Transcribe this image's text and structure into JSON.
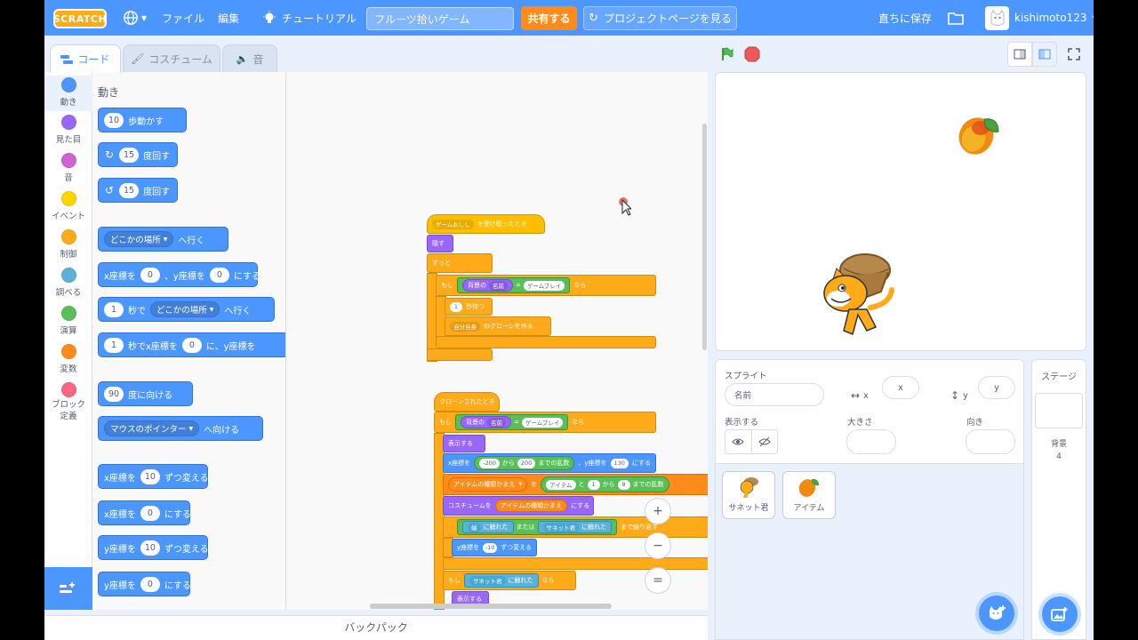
{
  "menubar": {
    "logo": "SCRATCH",
    "file": "ファイル",
    "edit": "編集",
    "tutorials": "チュートリアル",
    "project_title": "フルーツ拾いゲーム",
    "share": "共有する",
    "see_project_page": "プロジェクトページを見る",
    "save_now": "直ちに保存",
    "username": "kishimoto123"
  },
  "tabs": {
    "code": "コード",
    "costumes": "コスチューム",
    "sounds": "音"
  },
  "categories": [
    {
      "label": "動き",
      "color": "#4c97ff"
    },
    {
      "label": "見た目",
      "color": "#9966ff"
    },
    {
      "label": "音",
      "color": "#cf63cf"
    },
    {
      "label": "イベント",
      "color": "#ffd500"
    },
    {
      "label": "制御",
      "color": "#ffab19"
    },
    {
      "label": "調べる",
      "color": "#5cb1d6"
    },
    {
      "label": "演算",
      "color": "#59c059"
    },
    {
      "label": "変数",
      "color": "#ff8c1a"
    },
    {
      "label": "ブロック定義",
      "color": "#ff6680"
    }
  ],
  "palette": {
    "title": "動き",
    "blocks": {
      "move": {
        "v1": "10",
        "t1": "歩動かす"
      },
      "turn_right": {
        "v1": "15",
        "t1": "度回す"
      },
      "turn_left": {
        "v1": "15",
        "t1": "度回す"
      },
      "goto": {
        "dd": "どこかの場所",
        "t1": "へ行く"
      },
      "gotoxy": {
        "t1": "x座標を",
        "v1": "0",
        "t2": "、y座標を",
        "v2": "0",
        "t3": "にする"
      },
      "glide": {
        "v1": "1",
        "t1": "秒で",
        "dd": "どこかの場所",
        "t2": "へ行く"
      },
      "glidexy": {
        "v1": "1",
        "t1": "秒でx座標を",
        "v2": "0",
        "t2": "に、y座標を"
      },
      "point": {
        "v1": "90",
        "t1": "度に向ける"
      },
      "pointto": {
        "dd": "マウスのポインター",
        "t1": "へ向ける"
      },
      "changex": {
        "t1": "x座標を",
        "v1": "10",
        "t2": "ずつ変える"
      },
      "setx": {
        "t1": "x座標を",
        "v1": "0",
        "t2": "にする"
      },
      "changey": {
        "t1": "y座標を",
        "v1": "10",
        "t2": "ずつ変える"
      },
      "sety": {
        "t1": "y座標を",
        "v1": "0",
        "t2": "にする"
      }
    }
  },
  "script1": {
    "hat_dd": "ゲームおしし",
    "hat": "を受け取ったとき",
    "hide": "隠す",
    "forever": "ずっと",
    "if": "もし",
    "bg_name": "背景の",
    "name_dd": "名前",
    "eq": "=",
    "game_play": "ゲームプレイ",
    "then": "なら",
    "wait_v": "1",
    "wait": "秒待つ",
    "myself_dd": "自分自身",
    "clone": "のクローンを作る"
  },
  "script2": {
    "hat": "クローンされたとき",
    "if": "もし",
    "bg_name": "背景の",
    "name_dd": "名前",
    "eq": "=",
    "game_play": "ゲームプレイ",
    "then": "なら",
    "show": "表示する",
    "xlabel": "x座標を",
    "xmin": "-200",
    "from": "から",
    "xmax": "200",
    "rand": "までの乱数",
    "ylabel": "、y座標を",
    "yval": "130",
    "set": "にする",
    "var_dd": "アイテムの種類かまえ",
    "to": "を",
    "item": "アイテム",
    "and": "と",
    "r1": "1",
    "r2": "8",
    "costume": "コスチュームを",
    "costume_var": "アイテムの種類かまえ",
    "touch_dd": "端",
    "touching": "に触れた",
    "or": "または",
    "sanet_dd": "サネット君",
    "touching2": "に触れた",
    "until": "まで繰り返す",
    "ylab2": "y座標を",
    "dy": "-10",
    "change": "ずつ変える",
    "if2": "もし",
    "sanet2": "サネット君",
    "touching3": "に触れた",
    "then2": "なら",
    "show2": "表示する"
  },
  "zoom": {
    "in": "+",
    "out": "−",
    "reset": "="
  },
  "backpack": "バックパック",
  "sprite_panel": {
    "sprite_label": "スプライト",
    "name_placeholder": "名前",
    "x_label": "x",
    "x_placeholder": "x",
    "y_label": "y",
    "y_placeholder": "y",
    "show_label": "表示する",
    "size_label": "大きさ",
    "direction_label": "向き",
    "sprites": [
      "サネット君",
      "アイテム"
    ]
  },
  "stage_panel": {
    "title": "ステージ",
    "backdrops_label": "背景",
    "backdrops_count": "4"
  }
}
